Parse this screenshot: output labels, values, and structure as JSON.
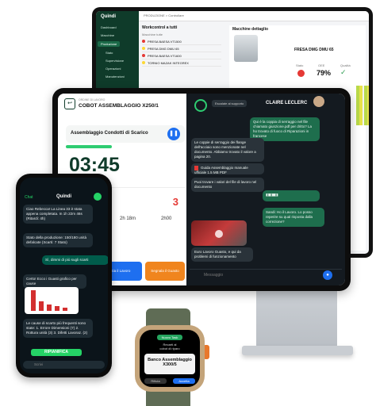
{
  "monitor": {
    "app_name": "Quindi",
    "breadcrumb": "PRODUZIONE > Controllare",
    "sidebar": [
      {
        "label": "Dashboard"
      },
      {
        "label": "Macchine"
      },
      {
        "label": "Produzione"
      },
      {
        "label": "Stato"
      },
      {
        "label": "Supervisione"
      },
      {
        "label": "Operazioni"
      },
      {
        "label": "Manutenzioni"
      }
    ],
    "list_title": "Workcontrol a tutti",
    "list_header": "Macchine tutte",
    "rows": [
      {
        "name": "PRESA BAESA VT1500",
        "color": "#e53935"
      },
      {
        "name": "PRESA DMG DMU 65",
        "color": "#fdd835"
      },
      {
        "name": "PRESA BAESA VT1600",
        "color": "#e53935"
      },
      {
        "name": "TORNIO MAZAK INTEGREX",
        "color": "#fdd835"
      }
    ],
    "detail_title": "Macchine dettaglio",
    "machine_name": "FRESA DMG DMU 65",
    "metrics": [
      {
        "label": "Stato"
      },
      {
        "label": "OEE",
        "value": "79%"
      },
      {
        "label": "Qualità"
      }
    ]
  },
  "tablet": {
    "order_label": "ORDINE DI LAVORO",
    "order_title": "COBOT ASSEMBLAGGIO X250/1",
    "task_title": "Assemblaggio Condotti di Scarico",
    "timer": "03:45",
    "counter": "3",
    "time_a": "2h 18m",
    "time_b": "2h00",
    "btn_lavoro": "Inizia il Lavoro",
    "btn_guasto": "Segnala il Guasto",
    "contact": "CLAIRE LECLERC",
    "escalate": "Escalate al supporto",
    "messages": [
      {
        "dir": "out",
        "text": "Qui è la coppia di serraggio nel file chiamato giunzione.pdf per dritto? La ho trovato di fuoco di Riparazioni in francese"
      },
      {
        "dir": "in",
        "text": "Le coppie di serraggio dei flange dell'acciaio sono menzionate nel documento. Abbiamo trovato il valore a pagina 20."
      },
      {
        "dir": "in",
        "text": "Guida Assemblaggio manuale ufficiale 1.5 MB PDF"
      },
      {
        "dir": "in",
        "text": "Puoi trovare i valori del file di lavoro nel documento"
      },
      {
        "dir": "out",
        "text": "Grazie, ecco il risultato"
      },
      {
        "dir": "out",
        "text": "Sandi: Ho il Lavoro. Lo posso reperire su qual risposta dalla correzione?"
      },
      {
        "dir": "in",
        "text": "Euro Lavoro Guasto, e qui da problemi di funzionamento"
      }
    ],
    "input_placeholder": "Messaggio"
  },
  "phone": {
    "back": "Chat",
    "title": "Quindi",
    "messages": [
      {
        "dir": "in",
        "text": "Ciao Rebecca! La Linea 33 è stata appena completata. In 1h 22m 46s (Ritardi: 4h)"
      },
      {
        "dir": "in",
        "text": "Stato della produzione: 150/180 unità defalcate (Scarti: 7 Stato)"
      },
      {
        "dir": "out",
        "text": "Sì, dimmi di più sugli scarti"
      },
      {
        "dir": "in",
        "text": "Certo! Ecco i Guasti grafico per cause"
      },
      {
        "dir": "in",
        "text": "Le cause di scarto più frequenti sono state: 1. Errore Dimensioni (7) 2. Rottura unità (3) 3. Difetti Lavoraz. (2)"
      }
    ],
    "chart_bars": [
      100,
      45,
      30,
      22,
      15
    ],
    "cta": "RIPIANIFICA",
    "input_placeholder": "Scrivi"
  },
  "watch": {
    "tag": "Nuovo Task",
    "line1": "Recarti al",
    "line2": "cobot di riparo",
    "product": "Banco Assemblaggio X300/5",
    "btn_a": "Rifiuta",
    "btn_b": "Accetta"
  }
}
